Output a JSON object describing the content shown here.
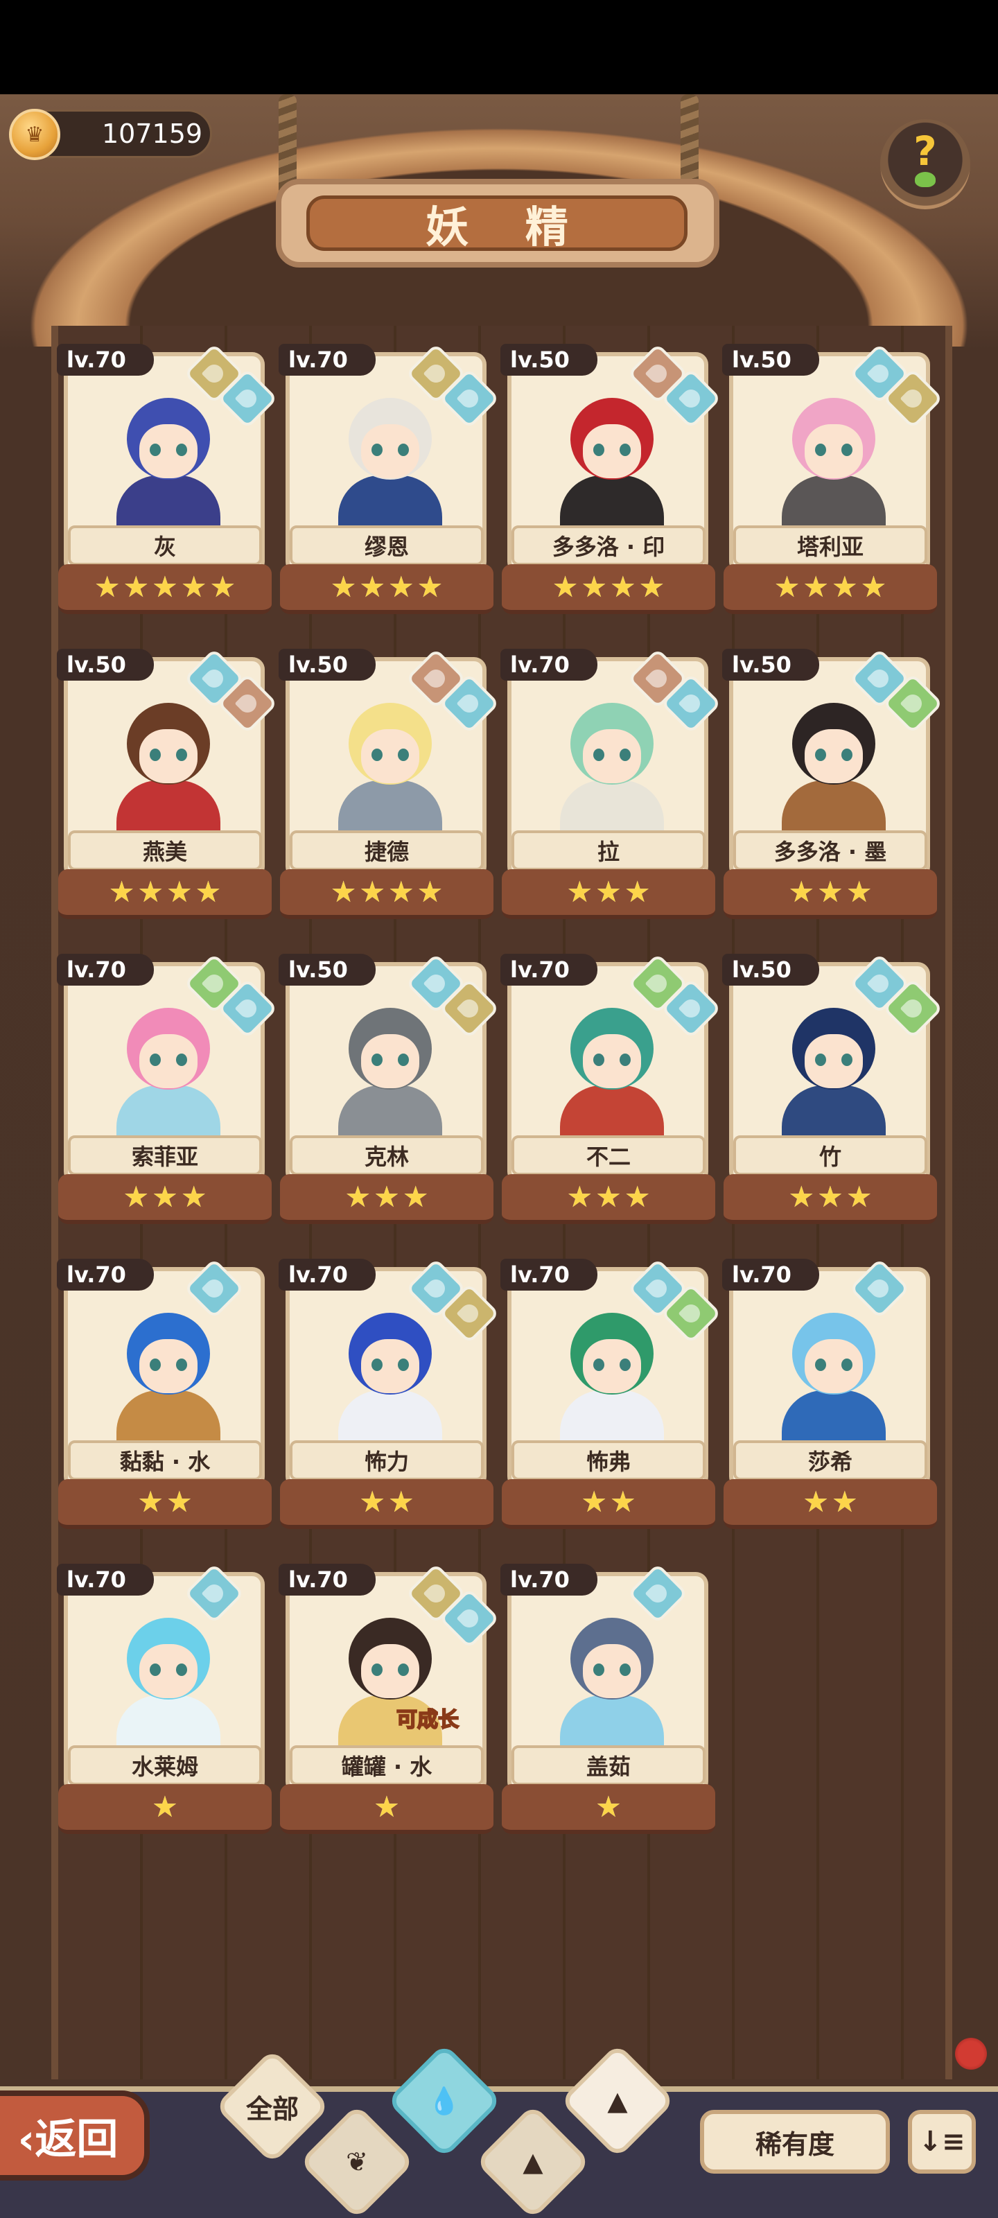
{
  "header": {
    "title": "妖 精",
    "coins": "107159",
    "help_icon": "?"
  },
  "cards": [
    {
      "level": "lv.70",
      "name": "灰",
      "stars": 5,
      "elements": [
        "earth",
        "water"
      ],
      "hair": "#3f4fb0",
      "outfit": "#3b3f8a"
    },
    {
      "level": "lv.70",
      "name": "缪恩",
      "stars": 4,
      "elements": [
        "earth",
        "water"
      ],
      "hair": "#e8e4dc",
      "outfit": "#2f4b8c"
    },
    {
      "level": "lv.50",
      "name": "多多洛 · 印",
      "stars": 4,
      "elements": [
        "fire",
        "water"
      ],
      "hair": "#c4262d",
      "outfit": "#2e2a2a"
    },
    {
      "level": "lv.50",
      "name": "塔利亚",
      "stars": 4,
      "elements": [
        "water",
        "earth"
      ],
      "hair": "#f0a5c6",
      "outfit": "#5a5656"
    },
    {
      "level": "lv.50",
      "name": "燕美",
      "stars": 4,
      "elements": [
        "water",
        "fire"
      ],
      "hair": "#6b3d26",
      "outfit": "#c23434"
    },
    {
      "level": "lv.50",
      "name": "捷德",
      "stars": 4,
      "elements": [
        "fire",
        "water"
      ],
      "hair": "#f4e08a",
      "outfit": "#8d9aa8"
    },
    {
      "level": "lv.70",
      "name": "拉",
      "stars": 3,
      "elements": [
        "fire",
        "water"
      ],
      "hair": "#8fd2b4",
      "outfit": "#e8e4d8"
    },
    {
      "level": "lv.50",
      "name": "多多洛 · 墨",
      "stars": 3,
      "elements": [
        "water",
        "wood"
      ],
      "hair": "#2d2524",
      "outfit": "#a36a3c"
    },
    {
      "level": "lv.70",
      "name": "索菲亚",
      "stars": 3,
      "elements": [
        "wood",
        "water"
      ],
      "hair": "#f18bb8",
      "outfit": "#9fd6e6"
    },
    {
      "level": "lv.50",
      "name": "克林",
      "stars": 3,
      "elements": [
        "water",
        "earth"
      ],
      "hair": "#6f7478",
      "outfit": "#8a8f94"
    },
    {
      "level": "lv.70",
      "name": "不二",
      "stars": 3,
      "elements": [
        "wood",
        "water"
      ],
      "hair": "#3aa08d",
      "outfit": "#c44435"
    },
    {
      "level": "lv.50",
      "name": "竹",
      "stars": 3,
      "elements": [
        "water",
        "wood"
      ],
      "hair": "#1f3466",
      "outfit": "#2f4a80"
    },
    {
      "level": "lv.70",
      "name": "黏黏 · 水",
      "stars": 2,
      "elements": [
        "water"
      ],
      "hair": "#2c6fcf",
      "outfit": "#c58b45"
    },
    {
      "level": "lv.70",
      "name": "怖力",
      "stars": 2,
      "elements": [
        "water",
        "earth"
      ],
      "hair": "#2f4fc2",
      "outfit": "#eef0f5"
    },
    {
      "level": "lv.70",
      "name": "怖弗",
      "stars": 2,
      "elements": [
        "water",
        "wood"
      ],
      "hair": "#2f9a6a",
      "outfit": "#eef0f5"
    },
    {
      "level": "lv.70",
      "name": "莎希",
      "stars": 2,
      "elements": [
        "water"
      ],
      "hair": "#77c4ea",
      "outfit": "#2f6ab8"
    },
    {
      "level": "lv.70",
      "name": "水莱姆",
      "stars": 1,
      "elements": [
        "water"
      ],
      "hair": "#6cd0ea",
      "outfit": "#eaf4f7"
    },
    {
      "level": "lv.70",
      "name": "罐罐 · 水",
      "stars": 1,
      "elements": [
        "earth",
        "water"
      ],
      "hair": "#3a2a24",
      "outfit": "#e9c772",
      "tag": "可成长"
    },
    {
      "level": "lv.70",
      "name": "盖茹",
      "stars": 1,
      "elements": [
        "water"
      ],
      "hair": "#5d6f8f",
      "outfit": "#8fd0e8"
    }
  ],
  "bottom": {
    "back_label": "‹返回",
    "filter_all": "全部",
    "filters": [
      "all",
      "wood",
      "water",
      "earth",
      "fire"
    ],
    "rarity_label": "稀有度",
    "sort_icon": "↓≡"
  },
  "colors": {
    "star": "#fcd54a",
    "water": "#7fc9d7",
    "earth": "#cbb56d",
    "fire": "#c79476",
    "wood": "#8fca72"
  }
}
